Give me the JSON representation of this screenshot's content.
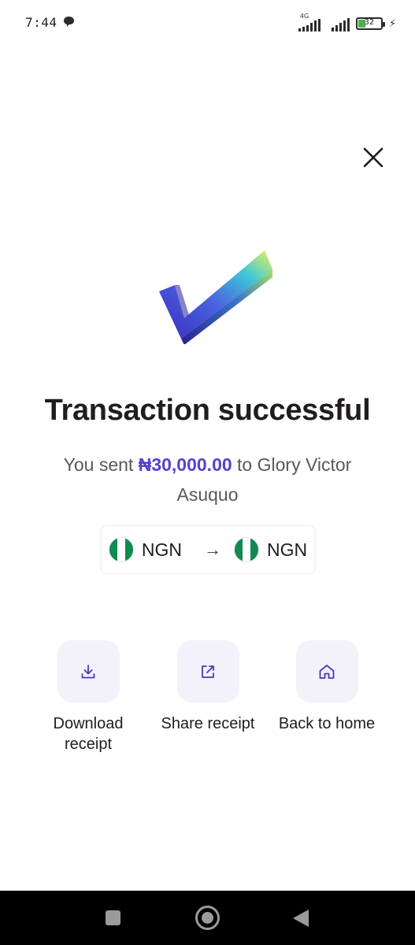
{
  "status_bar": {
    "time": "7:44",
    "network_tag": "4G",
    "battery_percent": "32",
    "battery_level": 0.32
  },
  "icons": {
    "close": "close-icon",
    "check": "check-mark-icon",
    "download": "download-icon",
    "share": "share-icon",
    "home": "home-icon"
  },
  "colors": {
    "accent": "#5a3fd1",
    "title": "#211d1e",
    "tile_bg": "#f3f2fb",
    "flag_green": "#0f8a50"
  },
  "result": {
    "title": "Transaction successful",
    "message_prefix": "You sent ",
    "amount": "₦30,000.00",
    "message_suffix": " to Glory Victor Asuquo"
  },
  "currency": {
    "from": "NGN",
    "to": "NGN"
  },
  "actions": {
    "download_label": "Download receipt",
    "share_label": "Share receipt",
    "home_label": "Back to home"
  }
}
